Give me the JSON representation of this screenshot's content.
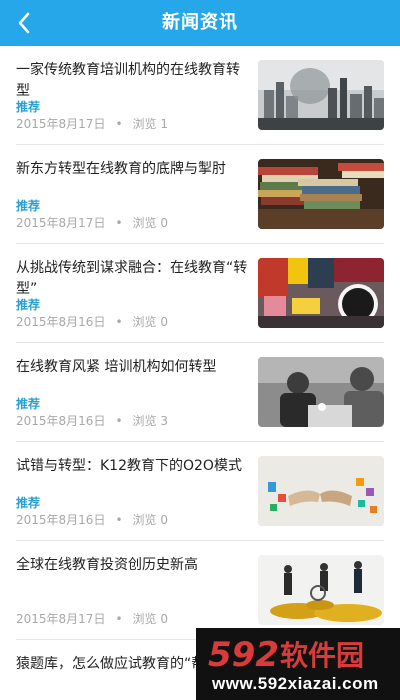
{
  "header": {
    "title": "新闻资讯",
    "back_icon": "chevron-left-icon",
    "color": "#25a7ea"
  },
  "news": [
    {
      "title": "一家传统教育培训机构的在线教育转型",
      "tag": "推荐",
      "date": "2015年8月17日",
      "views": "浏览 1",
      "image": "city-skyline-photo"
    },
    {
      "title": "新东方转型在线教育的底牌与掣肘",
      "tag": "推荐",
      "date": "2015年8月17日",
      "views": "浏览 0",
      "image": "book-stacks-photo"
    },
    {
      "title": "从挑战传统到谋求融合：在线教育“转型”",
      "tag": "推荐",
      "date": "2015年8月16日",
      "views": "浏览 0",
      "image": "street-signs-photo"
    },
    {
      "title": "在线教育风紧 培训机构如何转型",
      "tag": "推荐",
      "date": "2015年8月16日",
      "views": "浏览 3",
      "image": "meeting-people-photo"
    },
    {
      "title": "试错与转型：K12教育下的O2O模式",
      "tag": "推荐",
      "date": "2015年8月16日",
      "views": "浏览 0",
      "image": "handshake-apps-photo"
    },
    {
      "title": "全球在线教育投资创历史新高",
      "tag": "",
      "date": "2015年8月17日",
      "views": "浏览 0",
      "image": "businessmen-coins-photo"
    },
    {
      "title": "猿题库，怎么做应试教育的“帮凶”",
      "tag": "",
      "date": "",
      "views": "",
      "image": ""
    }
  ],
  "watermark": {
    "logo_text": "592软件园",
    "url": "www.592xiazai.com"
  }
}
